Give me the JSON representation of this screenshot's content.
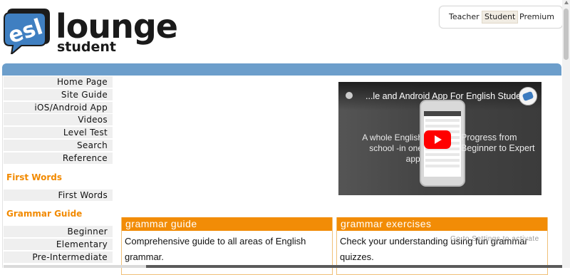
{
  "header": {
    "logo_word": "lounge",
    "logo_sub": "student",
    "logo_mark_text": "esl"
  },
  "audience_switcher": {
    "options": [
      "Teacher",
      "Student",
      "Premium"
    ],
    "selected": "Student"
  },
  "sidebar": {
    "items": [
      {
        "label": "Home Page"
      },
      {
        "label": "Site Guide"
      },
      {
        "label": "iOS/Android App"
      },
      {
        "label": "Videos"
      },
      {
        "label": "Level Test"
      },
      {
        "label": "Search"
      },
      {
        "label": "Reference"
      }
    ],
    "section_first_words": {
      "heading": "First Words",
      "items": [
        {
          "label": "First Words"
        }
      ]
    },
    "section_grammar_guide": {
      "heading": "Grammar Guide",
      "items": [
        {
          "label": "Beginner"
        },
        {
          "label": "Elementary"
        },
        {
          "label": "Pre-Intermediate"
        }
      ]
    }
  },
  "video": {
    "title": "...le and Android App For English Students",
    "left_text": "A whole English school -in one app!",
    "right_text": "Progress from Beginner to Expert",
    "play_icon": "youtube-play-icon"
  },
  "cards": {
    "grammar_guide": {
      "title": "grammar guide",
      "body": "Comprehensive guide to all areas of English grammar."
    },
    "grammar_exercises": {
      "title": "grammar exercises",
      "body": "Check your understanding using fun grammar quizzes."
    }
  },
  "watermark": "Go to Settings to activate",
  "colors": {
    "accent_orange": "#f28c06",
    "bar_blue": "#6c9ecb",
    "nav_bg": "#efefef"
  }
}
